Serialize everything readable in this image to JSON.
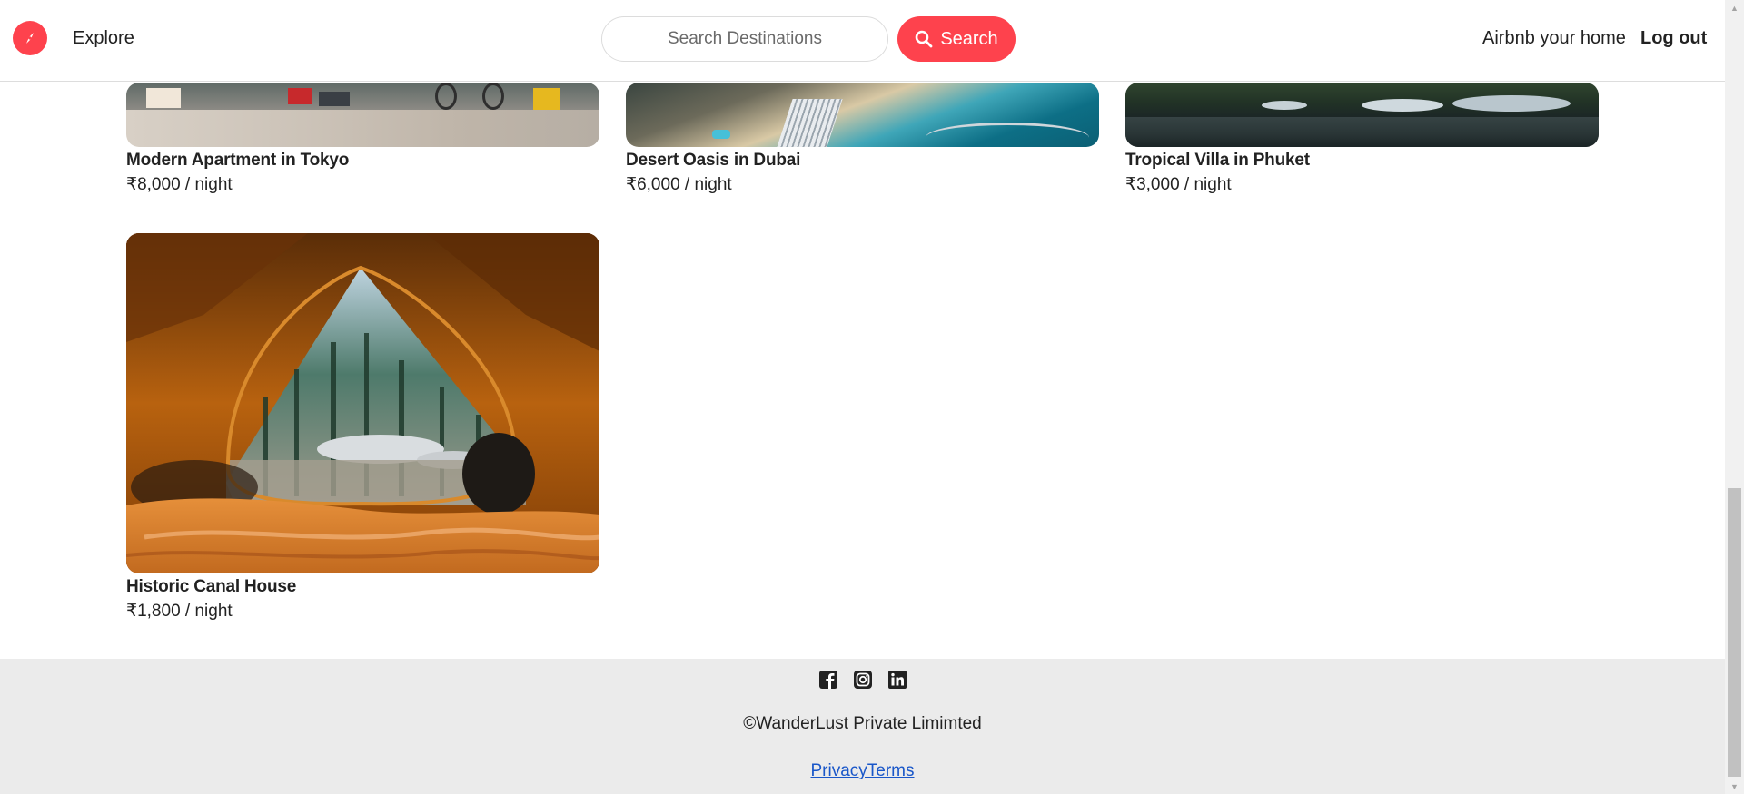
{
  "navbar": {
    "explore_label": "Explore",
    "search_placeholder": "Search Destinations",
    "search_button_label": "Search",
    "host_label": "Airbnb your home",
    "logout_label": "Log out"
  },
  "listings": [
    {
      "title": "Modern Apartment in Tokyo",
      "price": "₹8,000 / night"
    },
    {
      "title": "Desert Oasis in Dubai",
      "price": "₹6,000 / night"
    },
    {
      "title": "Tropical Villa in Phuket",
      "price": "₹3,000 / night"
    },
    {
      "title": "Historic Canal House",
      "price": "₹1,800 / night"
    }
  ],
  "footer": {
    "social_icons": [
      "facebook-icon",
      "instagram-icon",
      "linkedin-icon"
    ],
    "copyright": "©WanderLust Private Limimted",
    "privacy_label": "Privacy",
    "terms_label": "Terms"
  },
  "colors": {
    "brand": "#fe424d",
    "link": "#1a57c9",
    "footer_bg": "#ebebeb"
  }
}
